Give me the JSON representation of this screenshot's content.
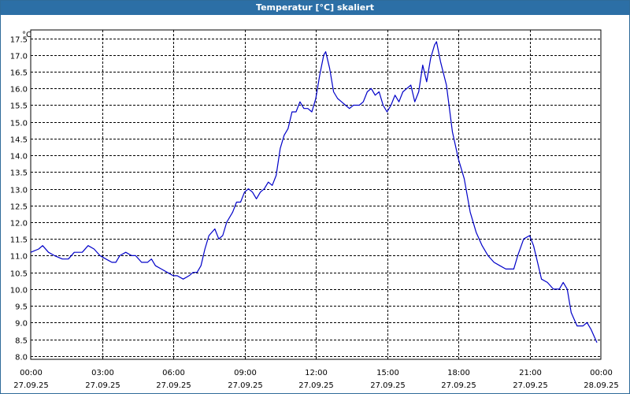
{
  "window": {
    "title": "Temperatur [°C] skaliert"
  },
  "colors": {
    "titlebar": "#2c6fa6",
    "line": "#0000c8",
    "grid": "#000000",
    "background": "#ffffff"
  },
  "chart_data": {
    "type": "line",
    "title": "Temperatur [°C] skaliert",
    "ylabel": "°C",
    "xlabel": "",
    "ylim": [
      7.9,
      17.75
    ],
    "xlim": [
      "2025-09-27 00:00",
      "2025-09-28 00:00"
    ],
    "grid": true,
    "yticks": [
      "8.0",
      "8.5",
      "9.0",
      "9.5",
      "10.0",
      "10.5",
      "11.0",
      "11.5",
      "12.0",
      "12.5",
      "13.0",
      "13.5",
      "14.0",
      "14.5",
      "15.0",
      "15.5",
      "16.0",
      "16.5",
      "17.0",
      "17.5"
    ],
    "xticks": [
      {
        "time": "00:00",
        "date": "27.09.25"
      },
      {
        "time": "03:00",
        "date": "27.09.25"
      },
      {
        "time": "06:00",
        "date": "27.09.25"
      },
      {
        "time": "09:00",
        "date": "27.09.25"
      },
      {
        "time": "12:00",
        "date": "27.09.25"
      },
      {
        "time": "15:00",
        "date": "27.09.25"
      },
      {
        "time": "18:00",
        "date": "27.09.25"
      },
      {
        "time": "21:00",
        "date": "27.09.25"
      },
      {
        "time": "00:00",
        "date": "28.09.25"
      }
    ],
    "series": [
      {
        "values": [
          [
            "2025-09-27 00:00",
            11.1
          ],
          [
            "2025-09-27 00:20",
            11.2
          ],
          [
            "2025-09-27 00:30",
            11.3
          ],
          [
            "2025-09-27 00:45",
            11.1
          ],
          [
            "2025-09-27 01:00",
            11.0
          ],
          [
            "2025-09-27 01:20",
            10.9
          ],
          [
            "2025-09-27 01:35",
            10.9
          ],
          [
            "2025-09-27 01:50",
            11.1
          ],
          [
            "2025-09-27 02:10",
            11.1
          ],
          [
            "2025-09-27 02:25",
            11.3
          ],
          [
            "2025-09-27 02:40",
            11.2
          ],
          [
            "2025-09-27 02:55",
            11.0
          ],
          [
            "2025-09-27 03:10",
            10.9
          ],
          [
            "2025-09-27 03:25",
            10.8
          ],
          [
            "2025-09-27 03:35",
            10.8
          ],
          [
            "2025-09-27 03:45",
            11.0
          ],
          [
            "2025-09-27 04:00",
            11.1
          ],
          [
            "2025-09-27 04:15",
            11.0
          ],
          [
            "2025-09-27 04:25",
            11.0
          ],
          [
            "2025-09-27 04:40",
            10.8
          ],
          [
            "2025-09-27 04:55",
            10.8
          ],
          [
            "2025-09-27 05:05",
            10.9
          ],
          [
            "2025-09-27 05:15",
            10.7
          ],
          [
            "2025-09-27 05:30",
            10.6
          ],
          [
            "2025-09-27 05:45",
            10.5
          ],
          [
            "2025-09-27 06:00",
            10.4
          ],
          [
            "2025-09-27 06:10",
            10.4
          ],
          [
            "2025-09-27 06:25",
            10.3
          ],
          [
            "2025-09-27 06:40",
            10.4
          ],
          [
            "2025-09-27 06:50",
            10.5
          ],
          [
            "2025-09-27 07:00",
            10.5
          ],
          [
            "2025-09-27 07:10",
            10.7
          ],
          [
            "2025-09-27 07:20",
            11.2
          ],
          [
            "2025-09-27 07:30",
            11.6
          ],
          [
            "2025-09-27 07:45",
            11.8
          ],
          [
            "2025-09-27 07:55",
            11.5
          ],
          [
            "2025-09-27 08:05",
            11.6
          ],
          [
            "2025-09-27 08:15",
            12.0
          ],
          [
            "2025-09-27 08:30",
            12.3
          ],
          [
            "2025-09-27 08:40",
            12.6
          ],
          [
            "2025-09-27 08:50",
            12.6
          ],
          [
            "2025-09-27 09:00",
            12.9
          ],
          [
            "2025-09-27 09:10",
            13.0
          ],
          [
            "2025-09-27 09:20",
            12.9
          ],
          [
            "2025-09-27 09:30",
            12.7
          ],
          [
            "2025-09-27 09:40",
            12.9
          ],
          [
            "2025-09-27 09:50",
            13.0
          ],
          [
            "2025-09-27 10:00",
            13.2
          ],
          [
            "2025-09-27 10:10",
            13.1
          ],
          [
            "2025-09-27 10:20",
            13.4
          ],
          [
            "2025-09-27 10:30",
            14.2
          ],
          [
            "2025-09-27 10:40",
            14.6
          ],
          [
            "2025-09-27 10:50",
            14.8
          ],
          [
            "2025-09-27 11:00",
            15.3
          ],
          [
            "2025-09-27 11:10",
            15.3
          ],
          [
            "2025-09-27 11:20",
            15.6
          ],
          [
            "2025-09-27 11:30",
            15.4
          ],
          [
            "2025-09-27 11:40",
            15.4
          ],
          [
            "2025-09-27 11:50",
            15.3
          ],
          [
            "2025-09-27 12:00",
            15.7
          ],
          [
            "2025-09-27 12:10",
            16.4
          ],
          [
            "2025-09-27 12:20",
            17.0
          ],
          [
            "2025-09-27 12:25",
            17.1
          ],
          [
            "2025-09-27 12:35",
            16.6
          ],
          [
            "2025-09-27 12:45",
            15.9
          ],
          [
            "2025-09-27 12:55",
            15.7
          ],
          [
            "2025-09-27 13:05",
            15.6
          ],
          [
            "2025-09-27 13:15",
            15.5
          ],
          [
            "2025-09-27 13:25",
            15.4
          ],
          [
            "2025-09-27 13:35",
            15.5
          ],
          [
            "2025-09-27 13:50",
            15.5
          ],
          [
            "2025-09-27 14:00",
            15.6
          ],
          [
            "2025-09-27 14:10",
            15.9
          ],
          [
            "2025-09-27 14:20",
            16.0
          ],
          [
            "2025-09-27 14:30",
            15.8
          ],
          [
            "2025-09-27 14:40",
            15.9
          ],
          [
            "2025-09-27 14:50",
            15.5
          ],
          [
            "2025-09-27 15:00",
            15.3
          ],
          [
            "2025-09-27 15:10",
            15.5
          ],
          [
            "2025-09-27 15:20",
            15.8
          ],
          [
            "2025-09-27 15:30",
            15.6
          ],
          [
            "2025-09-27 15:40",
            15.9
          ],
          [
            "2025-09-27 15:50",
            16.0
          ],
          [
            "2025-09-27 16:00",
            16.1
          ],
          [
            "2025-09-27 16:10",
            15.6
          ],
          [
            "2025-09-27 16:20",
            15.9
          ],
          [
            "2025-09-27 16:30",
            16.7
          ],
          [
            "2025-09-27 16:40",
            16.2
          ],
          [
            "2025-09-27 16:50",
            16.9
          ],
          [
            "2025-09-27 17:00",
            17.3
          ],
          [
            "2025-09-27 17:05",
            17.4
          ],
          [
            "2025-09-27 17:15",
            16.8
          ],
          [
            "2025-09-27 17:30",
            16.1
          ],
          [
            "2025-09-27 17:45",
            14.7
          ],
          [
            "2025-09-27 18:00",
            13.9
          ],
          [
            "2025-09-27 18:15",
            13.3
          ],
          [
            "2025-09-27 18:30",
            12.3
          ],
          [
            "2025-09-27 18:45",
            11.7
          ],
          [
            "2025-09-27 19:00",
            11.3
          ],
          [
            "2025-09-27 19:15",
            11.0
          ],
          [
            "2025-09-27 19:30",
            10.8
          ],
          [
            "2025-09-27 19:45",
            10.7
          ],
          [
            "2025-09-27 20:00",
            10.6
          ],
          [
            "2025-09-27 20:10",
            10.6
          ],
          [
            "2025-09-27 20:20",
            10.6
          ],
          [
            "2025-09-27 20:30",
            11.0
          ],
          [
            "2025-09-27 20:45",
            11.5
          ],
          [
            "2025-09-27 21:00",
            11.6
          ],
          [
            "2025-09-27 21:10",
            11.3
          ],
          [
            "2025-09-27 21:20",
            10.8
          ],
          [
            "2025-09-27 21:30",
            10.3
          ],
          [
            "2025-09-27 21:45",
            10.2
          ],
          [
            "2025-09-27 22:00",
            10.0
          ],
          [
            "2025-09-27 22:15",
            10.0
          ],
          [
            "2025-09-27 22:25",
            10.2
          ],
          [
            "2025-09-27 22:35",
            10.0
          ],
          [
            "2025-09-27 22:45",
            9.3
          ],
          [
            "2025-09-27 23:00",
            8.9
          ],
          [
            "2025-09-27 23:15",
            8.9
          ],
          [
            "2025-09-27 23:25",
            9.0
          ],
          [
            "2025-09-27 23:35",
            8.8
          ],
          [
            "2025-09-27 23:50",
            8.4
          ]
        ]
      }
    ]
  }
}
